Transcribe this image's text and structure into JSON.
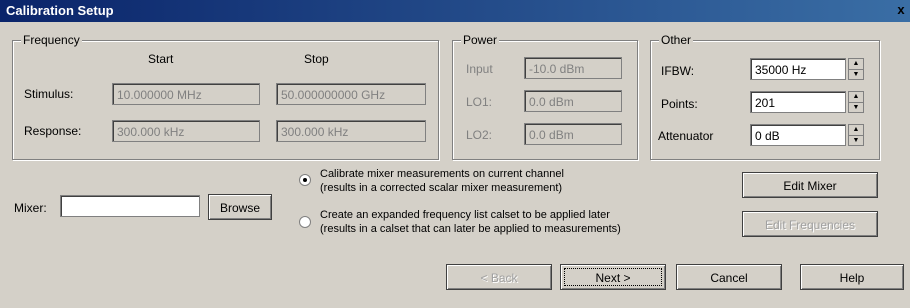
{
  "window": {
    "title": "Calibration Setup",
    "close_glyph": "x"
  },
  "frequency": {
    "group_label": "Frequency",
    "col_start": "Start",
    "col_stop": "Stop",
    "stimulus_label": "Stimulus:",
    "stimulus_start": "10.000000 MHz",
    "stimulus_stop": "50.000000000 GHz",
    "response_label": "Response:",
    "response_start": "300.000 kHz",
    "response_stop": "300.000 kHz"
  },
  "power": {
    "group_label": "Power",
    "input_label": "Input",
    "input_value": "-10.0 dBm",
    "lo1_label": "LO1:",
    "lo1_value": "0.0 dBm",
    "lo2_label": "LO2:",
    "lo2_value": "0.0 dBm"
  },
  "other": {
    "group_label": "Other",
    "ifbw_label": "IFBW:",
    "ifbw_value": "35000 Hz",
    "points_label": "Points:",
    "points_value": "201",
    "attenuator_label": "Attenuator",
    "attenuator_value": "0 dB"
  },
  "mixer": {
    "label": "Mixer:",
    "value": "",
    "browse_label": "Browse"
  },
  "options": [
    {
      "line1": "Calibrate mixer measurements on current channel",
      "line2": "(results in a corrected scalar mixer measurement)",
      "selected": true
    },
    {
      "line1": "Create an expanded frequency list calset to be applied later",
      "line2": "(results in a calset that can later be applied to measurements)",
      "selected": false
    }
  ],
  "buttons": {
    "edit_mixer": "Edit Mixer",
    "edit_frequencies": "Edit Frequencies",
    "back": "< Back",
    "next": "Next >",
    "cancel": "Cancel",
    "help": "Help"
  },
  "icons": {
    "spin_up": "up-arrow",
    "spin_down": "down-arrow"
  }
}
